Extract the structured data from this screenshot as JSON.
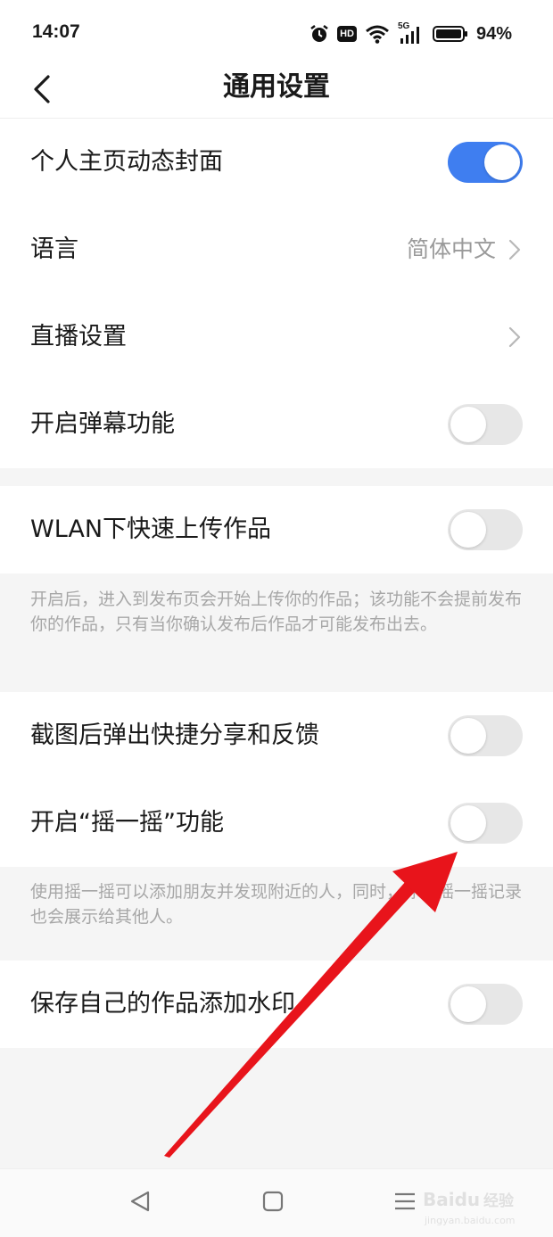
{
  "status_bar": {
    "time": "14:07",
    "hd": "HD",
    "network": "5G",
    "battery": "94%"
  },
  "header": {
    "title": "通用设置"
  },
  "settings": {
    "dynamic_cover": {
      "label": "个人主页动态封面",
      "enabled": true
    },
    "language": {
      "label": "语言",
      "value": "简体中文"
    },
    "live_settings": {
      "label": "直播设置"
    },
    "danmaku": {
      "label": "开启弹幕功能",
      "enabled": false
    },
    "wlan_upload": {
      "label": "WLAN下快速上传作品",
      "enabled": false,
      "description": "开启后，进入到发布页会开始上传你的作品；该功能不会提前发布你的作品，只有当你确认发布后作品才可能发布出去。"
    },
    "screenshot_share": {
      "label": "截图后弹出快捷分享和反馈",
      "enabled": false
    },
    "shake": {
      "label": "开启“摇一摇”功能",
      "enabled": false,
      "description": "使用摇一摇可以添加朋友并发现附近的人，同时，你的摇一摇记录也会展示给其他人。"
    },
    "watermark_save": {
      "label": "保存自己的作品添加水印",
      "enabled": false
    }
  },
  "colors": {
    "toggle_on": "#3f7ef0",
    "toggle_off": "#e7e7e7",
    "annotation_arrow": "#e8141b"
  },
  "watermark": {
    "brand": "Baidu",
    "suffix": "经验",
    "domain": "jingyan.baidu.com"
  }
}
